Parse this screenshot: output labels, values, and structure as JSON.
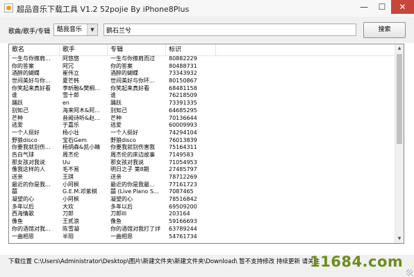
{
  "window": {
    "title": "超品音乐下载工具 V1.2 52pojie By iPhone8Plus",
    "minimize_glyph": "—",
    "maximize_glyph": "☐",
    "close_glyph": "✕"
  },
  "search": {
    "filter_label": "歌曲/歌手/专辑",
    "source_selected": "酷我音乐",
    "query_value": "鹅石兰兮",
    "search_button_label": "搜索"
  },
  "table": {
    "columns": [
      "歌名",
      "歌手",
      "专辑",
      "标识"
    ],
    "rows": [
      [
        "一生与你擦肩...",
        "阿悠悠",
        "一生与你擦肩而过",
        "80882229"
      ],
      [
        "你的答案",
        "阿冗",
        "你的答案",
        "80488731"
      ],
      [
        "酒醉的蝴蝶",
        "崔伟立",
        "酒醉的蝴蝶",
        "73343932"
      ],
      [
        "世间美好与你...",
        "夏芒韩",
        "世间美好与你环...",
        "80150867"
      ],
      [
        "你笑起来真好看",
        "李昕融&樊桐...",
        "你笑起来真好看",
        "68481158"
      ],
      [
        "谁",
        "雪十郎",
        "谁",
        "76218509"
      ],
      [
        "踊跃",
        "en",
        "踊跃",
        "73391335"
      ],
      [
        "别知己",
        "海来阿木&阿...",
        "别知己",
        "64685295"
      ],
      [
        "芒种",
        "音阙诗听&赵...",
        "芒种",
        "70136644"
      ],
      [
        "逃爱",
        "于嘉乐",
        "逃爱",
        "60009993"
      ],
      [
        "一个人挺好",
        "杨小壮",
        "一个人挺好",
        "74294104"
      ],
      [
        "野狼disco",
        "宝石Gem",
        "野狼disco",
        "76013839"
      ],
      [
        "你要我就别伤...",
        "杨炳森&凯小睛",
        "你要我就别伤害我",
        "75164311"
      ],
      [
        "告白气球",
        "周杰伦",
        "周杰伦的床边故事",
        "7149583"
      ],
      [
        "那女孩对我说",
        "Uu",
        "那女孩对我说",
        "71054953"
      ],
      [
        "像我这样的人",
        "毛不易",
        "明日之子 第8期",
        "27485797"
      ],
      [
        "送亲",
        "王琪",
        "送亲",
        "78712269"
      ],
      [
        "最近的你是我...",
        "小阿枫",
        "最近的你是我最...",
        "77161723"
      ],
      [
        "囍",
        "G.E.M.邓紫棋",
        "囍 (Live Piano S...",
        "7087465"
      ],
      [
        "凝望的心",
        "小阿枫",
        "凝望的心",
        "78516842"
      ],
      [
        "多年以后",
        "大欢",
        "多年以后",
        "69509200"
      ],
      [
        "西海情歌",
        "刀郎",
        "刀郎III",
        "203164"
      ],
      [
        "像鱼",
        "王贰浪",
        "像鱼",
        "59166693"
      ],
      [
        "你的酒馆对我...",
        "陈雪凝",
        "你的酒馆对我打了烊",
        "63789244"
      ],
      [
        "一曲相思",
        "半阳",
        "一曲相思",
        "54761734"
      ]
    ]
  },
  "status": {
    "text": "下载位置 C:\\Users\\Administrator\\Desktop\\图片\\新建文件夹\\新建文件夹\\Download\\ 暂不支持修改 持续更新 请关注"
  },
  "watermark": {
    "text": "11684.com"
  }
}
